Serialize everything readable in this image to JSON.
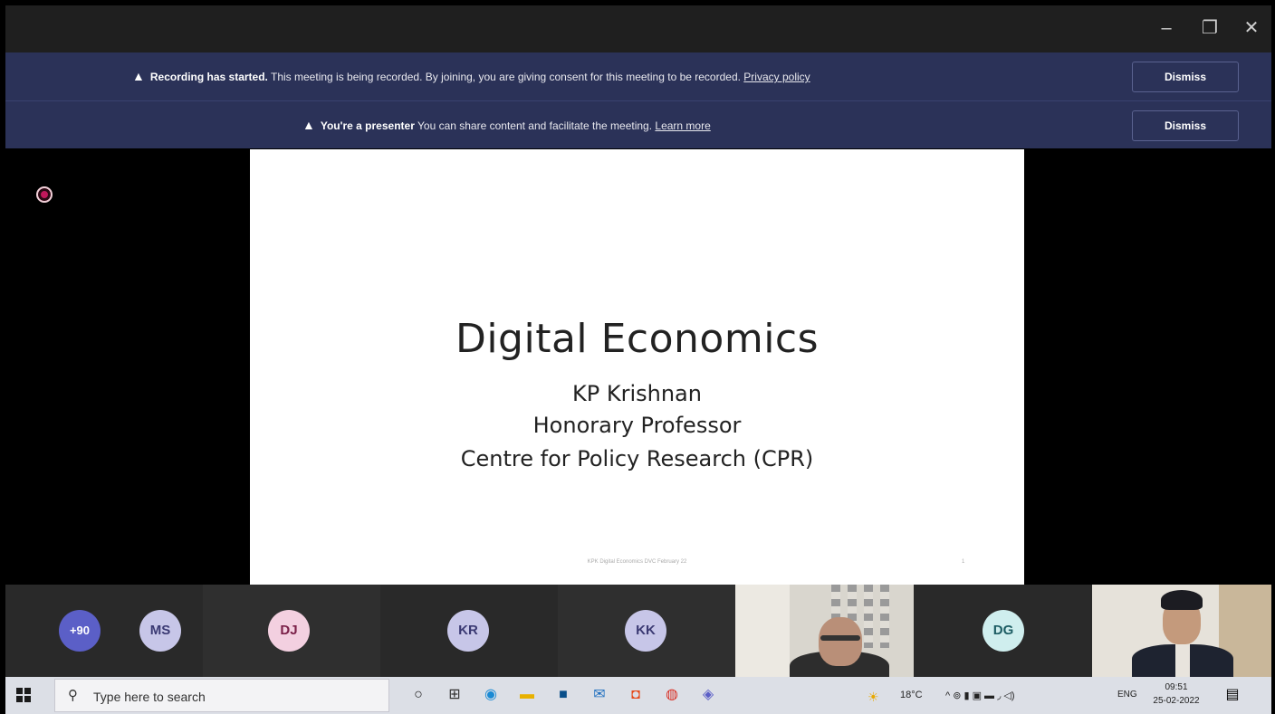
{
  "window": {
    "minimize_icon": "minimize-icon",
    "maximize_icon": "maximize-icon",
    "close_icon": "close-icon",
    "minimize_glyph": "–",
    "maximize_glyph": "❐",
    "close_glyph": "✕"
  },
  "banners": [
    {
      "icon": "warning-icon",
      "glyph": "▲",
      "bold": "Recording has started.",
      "text": " This meeting is being recorded. By joining, you are giving consent for this meeting to be recorded. ",
      "link": "Privacy policy",
      "dismiss": "Dismiss"
    },
    {
      "icon": "warning-icon",
      "glyph": "▲",
      "bold": "You're a presenter",
      "text": " You can share content and facilitate the meeting. ",
      "link": "Learn more",
      "dismiss": "Dismiss"
    }
  ],
  "slide": {
    "title": "Digital Economics",
    "lines": [
      "KP Krishnan",
      "Honorary Professor",
      "Centre for Policy Research (CPR)"
    ],
    "footer": "KPK Digital Economics DVC February 22",
    "page_number": "1"
  },
  "participants": [
    {
      "initials": "+90"
    },
    {
      "initials": "MS"
    },
    {
      "initials": "DJ"
    },
    {
      "initials": "KR"
    },
    {
      "initials": "KK"
    },
    {
      "initials": "DG"
    }
  ],
  "taskbar": {
    "search_placeholder": "Type here to search",
    "search_glyph": "⚲",
    "apps": [
      {
        "name": "cortana-icon",
        "glyph": "○",
        "color": "#222222"
      },
      {
        "name": "task-view-icon",
        "glyph": "⊞",
        "color": "#333333"
      },
      {
        "name": "edge-icon",
        "glyph": "◉",
        "color": "#1a8ad4"
      },
      {
        "name": "file-explorer-icon",
        "glyph": "▬",
        "color": "#e8b100"
      },
      {
        "name": "store-icon",
        "glyph": "■",
        "color": "#0a4f8a"
      },
      {
        "name": "mail-icon",
        "glyph": "✉",
        "color": "#1f6fc0"
      },
      {
        "name": "office-icon",
        "glyph": "◘",
        "color": "#e64a19"
      },
      {
        "name": "chrome-icon",
        "glyph": "◍",
        "color": "#d93025"
      },
      {
        "name": "teams-icon",
        "glyph": "◈",
        "color": "#5b5fc7"
      }
    ],
    "weather": "18°C",
    "weather_glyph": "☀",
    "language": "ENG",
    "time": "09:51",
    "date": "25-02-2022",
    "tray_glyphs": "^ ⊚ ▮ ▣ ▬ ◞ ◁)",
    "notification_glyph": "▤"
  }
}
